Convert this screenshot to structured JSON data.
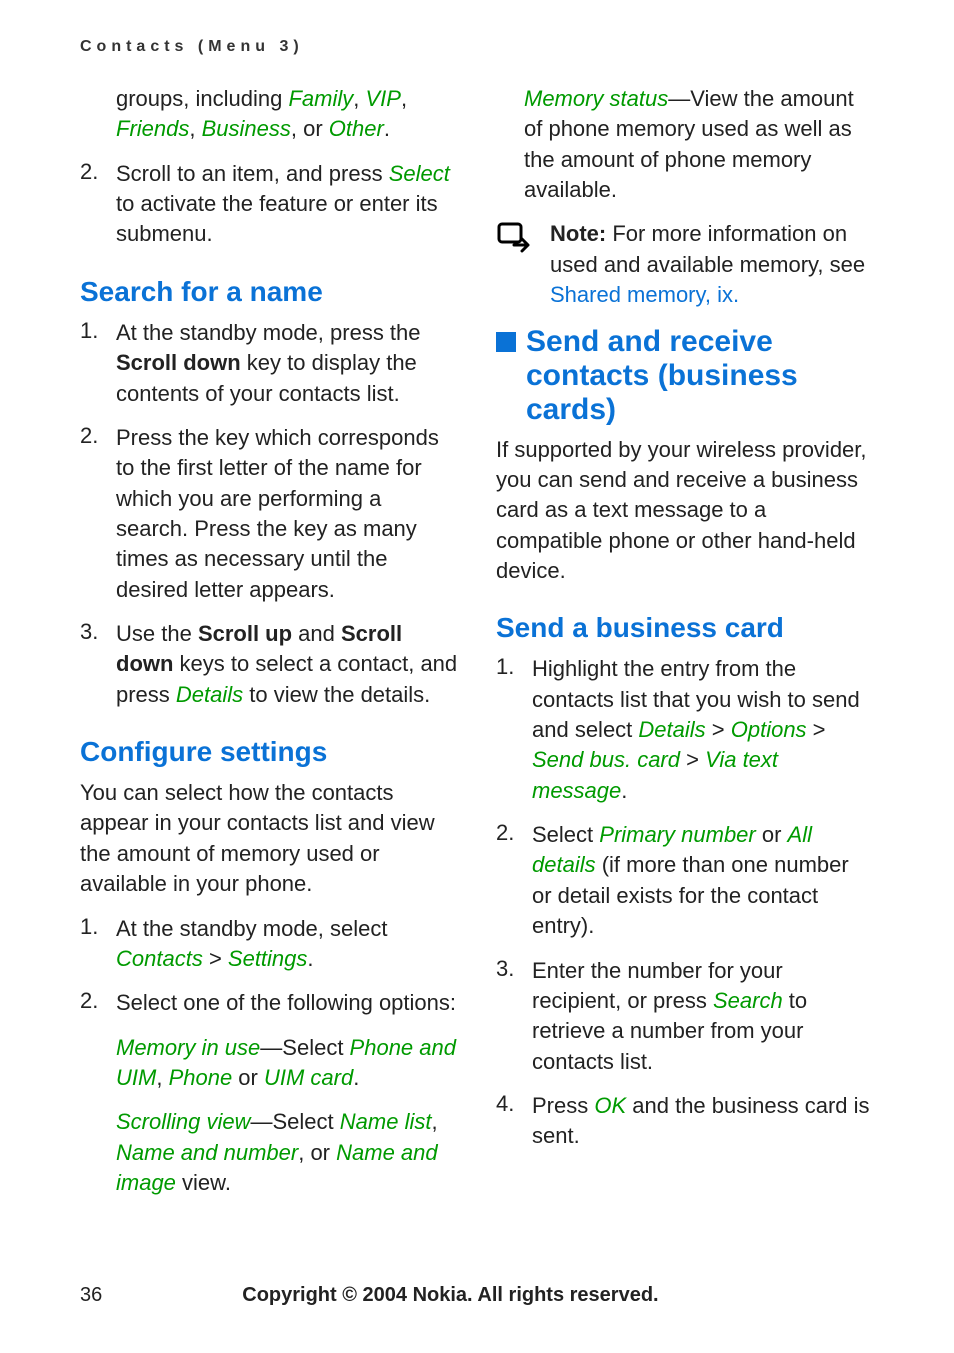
{
  "header": "Contacts (Menu 3)",
  "left": {
    "intro_l1a": "groups, including ",
    "intro_family": "Family",
    "intro_vip": "VIP",
    "intro_friends": "Friends",
    "intro_business": "Business",
    "intro_or": ", or ",
    "intro_other": "Other",
    "intro_period": ".",
    "step2_a": "Scroll to an item, and press ",
    "step2_select": "Select",
    "step2_b": " to activate the feature or enter its submenu.",
    "search_heading": "Search for a name",
    "search_1a": "At the standby mode, press the ",
    "search_1b": "Scroll down",
    "search_1c": " key to display the contents of your contacts list.",
    "search_2": "Press the key which corresponds to the first letter of the name for which you are performing a search. Press the key as many times as necessary until the desired letter appears.",
    "search_3a": "Use the ",
    "search_3b": "Scroll up",
    "search_3c": " and ",
    "search_3d": "Scroll down",
    "search_3e": " keys to select a contact, and press ",
    "search_3f": "Details",
    "search_3g": " to view the details.",
    "config_heading": "Configure settings",
    "config_intro": "You can select how the contacts appear in your contacts list and view the amount of memory used or available in your phone.",
    "config_1a": "At the standby mode, select ",
    "config_1b": "Contacts",
    "config_1c": " > ",
    "config_1d": "Settings",
    "config_1e": ".",
    "config_2": "Select one of the following options:",
    "mem_in_use_a": "Memory in use",
    "mem_in_use_b": "—Select ",
    "mem_in_use_c": "Phone and UIM",
    "mem_in_use_d": ", ",
    "mem_in_use_e": "Phone",
    "mem_in_use_f": " or ",
    "mem_in_use_g": "UIM card",
    "mem_in_use_h": ".",
    "scroll_view_a": "Scrolling view",
    "scroll_view_b": "—Select ",
    "scroll_view_c": "Name list",
    "scroll_view_d": ", ",
    "scroll_view_e": "Name and number",
    "scroll_view_f": ", or ",
    "scroll_view_g": "Name and image",
    "scroll_view_h": " view."
  },
  "right": {
    "memstatus_a": "Memory status",
    "memstatus_b": "—View the amount of phone memory used as well as the amount of phone memory available.",
    "note_label": "Note:",
    "note_a": " For more information on used and available memory, see ",
    "note_link": "Shared memory, ix.",
    "section_heading": "Send and receive contacts (business cards)",
    "section_intro": "If supported by your wireless provider, you can send and receive a business card as a text message to a compatible phone or other hand-held device.",
    "send_heading": "Send a business card",
    "send_1a": "Highlight the entry from the contacts list that you wish to send and select ",
    "send_1b": "Details",
    "send_1c": " > ",
    "send_1d": "Options",
    "send_1e": " > ",
    "send_1f": "Send bus. card",
    "send_1g": " > ",
    "send_1h": "Via text message",
    "send_1i": ".",
    "send_2a": "Select ",
    "send_2b": "Primary number",
    "send_2c": " or ",
    "send_2d": "All details",
    "send_2e": " (if more than one number or detail exists for the contact entry).",
    "send_3a": "Enter the number for your recipient, or press ",
    "send_3b": "Search",
    "send_3c": " to retrieve a number from your contacts list.",
    "send_4a": "Press ",
    "send_4b": "OK",
    "send_4c": " and the business card is sent."
  },
  "footer": {
    "page": "36",
    "copyright": "Copyright © 2004 Nokia. All rights reserved."
  },
  "numbers": {
    "n1": "1.",
    "n2": "2.",
    "n3": "3.",
    "n4": "4."
  },
  "sep": {
    "comma_sp": ", "
  }
}
